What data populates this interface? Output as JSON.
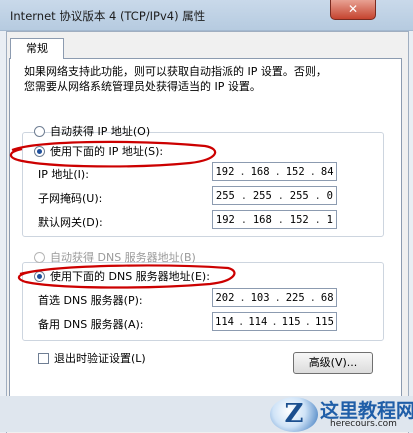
{
  "window": {
    "title": "Internet 协议版本 4 (TCP/IPv4) 属性",
    "close_label": "✕"
  },
  "tabs": [
    {
      "label": "常规"
    }
  ],
  "description": [
    "如果网络支持此功能，则可以获取自动指派的 IP 设置。否则，",
    "您需要从网络系统管理员处获得适当的 IP 设置。"
  ],
  "ip_section": {
    "auto_label": "自动获得 IP 地址(O)",
    "manual_label": "使用下面的 IP 地址(S):",
    "selected": "manual",
    "fields": [
      {
        "label": "IP 地址(I):",
        "octets": [
          "192",
          "168",
          "152",
          "84"
        ]
      },
      {
        "label": "子网掩码(U):",
        "octets": [
          "255",
          "255",
          "255",
          "0"
        ]
      },
      {
        "label": "默认网关(D):",
        "octets": [
          "192",
          "168",
          "152",
          "1"
        ]
      }
    ]
  },
  "dns_section": {
    "auto_label": "自动获得 DNS 服务器地址(B)",
    "manual_label": "使用下面的 DNS 服务器地址(E):",
    "selected": "manual",
    "fields": [
      {
        "label": "首选 DNS 服务器(P):",
        "octets": [
          "202",
          "103",
          "225",
          "68"
        ]
      },
      {
        "label": "备用 DNS 服务器(A):",
        "octets": [
          "114",
          "114",
          "115",
          "115"
        ]
      }
    ]
  },
  "validate_on_exit": {
    "label": "退出时验证设置(L)",
    "checked": false
  },
  "advanced_button": "高级(V)...",
  "watermark": {
    "logo": "Z",
    "title": "这里教程网",
    "url": "herecours.com"
  },
  "colors": {
    "annotation": "#cc0000",
    "accent": "#1e4f9c"
  }
}
